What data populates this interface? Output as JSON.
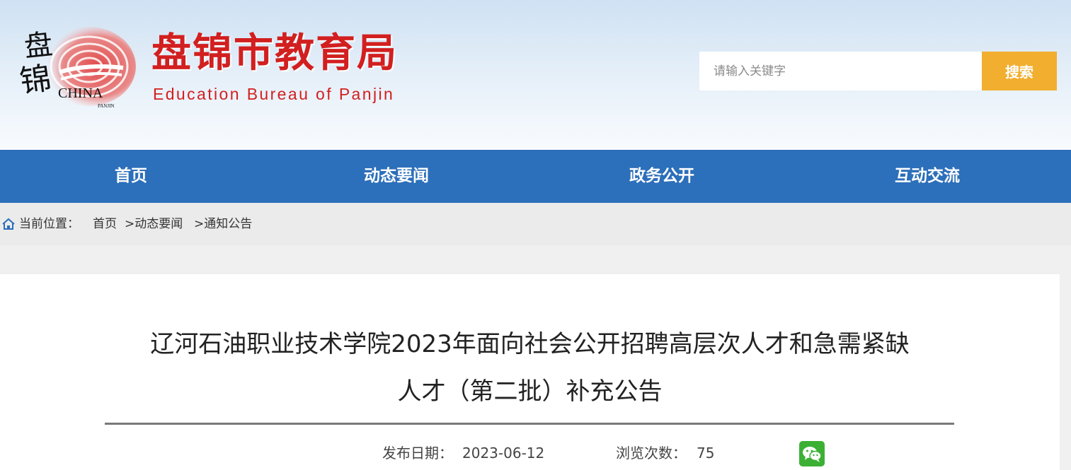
{
  "header": {
    "logo": {
      "glyph_top": "盘",
      "glyph_bottom": "锦",
      "text": "CHINA",
      "subtext": "PANJIN"
    },
    "title": "盘锦市教育局",
    "subtitle": "Education Bureau of Panjin",
    "search": {
      "placeholder": "请输入关键字",
      "value": "",
      "button_label": "搜索"
    },
    "colors": {
      "brand_red": "#d21f1f",
      "search_button": "#f2ae2f"
    }
  },
  "nav": {
    "items": [
      {
        "label": "首页"
      },
      {
        "label": "动态要闻"
      },
      {
        "label": "政务公开"
      },
      {
        "label": "互动交流"
      }
    ],
    "background": "#2c6fba"
  },
  "breadcrumb": {
    "icon": "home-icon",
    "prefix": "当前位置：",
    "items": [
      {
        "label": "首页"
      },
      {
        "label": ">动态要闻"
      },
      {
        "label": ">通知公告"
      }
    ]
  },
  "article": {
    "title_line1": "辽河石油职业技术学院2023年面向社会公开招聘高层次人才和急需紧缺",
    "title_line2": "人才（第二批）补充公告",
    "publish_label": "发布日期：",
    "publish_date": "2023-06-12",
    "views_label": "浏览次数：",
    "views": "75",
    "share_icon": "wechat-icon"
  }
}
